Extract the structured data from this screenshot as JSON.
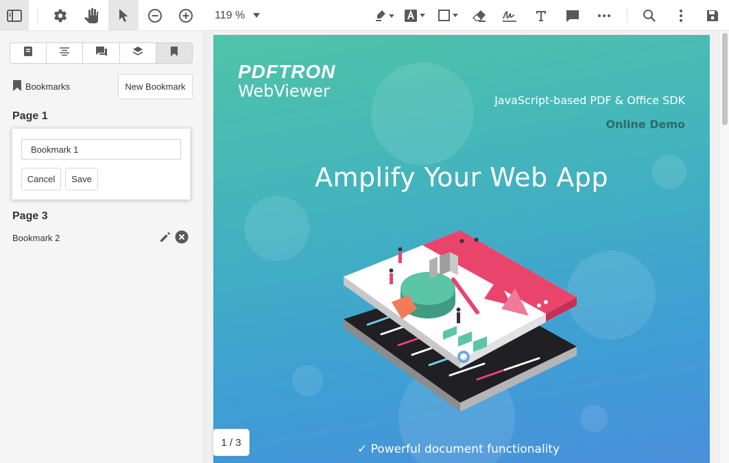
{
  "toolbar": {
    "zoom": "119 %",
    "icons": [
      "panel-toggle-icon",
      "gear-icon",
      "hand-icon",
      "pointer-icon",
      "zoom-out-icon",
      "zoom-in-icon",
      "highlighter-icon",
      "text-style-icon",
      "rectangle-icon",
      "eraser-icon",
      "signature-icon",
      "text-icon",
      "comment-icon",
      "more-icon",
      "search-icon",
      "kebab-icon",
      "save-icon"
    ]
  },
  "left_panel": {
    "tabs": [
      "thumbnails-icon",
      "outline-icon",
      "comments-icon",
      "layers-icon",
      "bookmarks-icon"
    ],
    "bookmarks_title": "Bookmarks",
    "new_bookmark_label": "New Bookmark",
    "page1_label": "Page 1",
    "edit_card": {
      "input_value": "Bookmark 1",
      "cancel_label": "Cancel",
      "save_label": "Save"
    },
    "page3_label": "Page 3",
    "bookmark2_label": "Bookmark 2"
  },
  "document": {
    "logo": "PDFTRON",
    "logo_sub": "WebViewer",
    "tagline": "JavaScript-based PDF & Office SDK",
    "demo_label": "Online Demo",
    "headline": "Amplify Your Web App",
    "bullet": "✓ Powerful document functionality",
    "page_indicator": "1 / 3",
    "colors": {
      "gradient_top": "#4fc4a8",
      "gradient_bottom": "#4a8edc",
      "accent_pink": "#e9456c"
    }
  }
}
